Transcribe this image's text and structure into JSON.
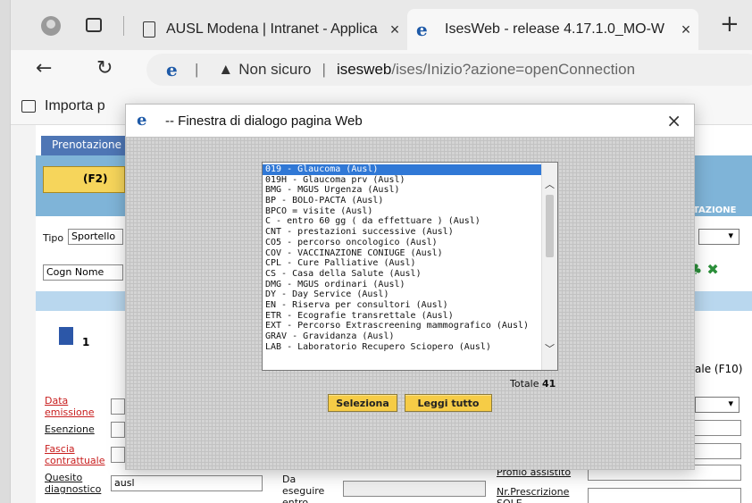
{
  "browser": {
    "tabs": [
      {
        "label": "AUSL Modena | Intranet - Applica",
        "close": "×"
      },
      {
        "label": "IsesWeb - release 4.17.1.0_MO-W",
        "close": "×"
      }
    ],
    "new_tab": "+",
    "address": {
      "security": "Non sicuro",
      "host": "isesweb",
      "path": "/ises/Inizio?azione=openConnection"
    },
    "favorites": [
      {
        "label": "Importa p"
      }
    ]
  },
  "background_page": {
    "top_tab": "Prenotazione",
    "tool_button": "(F2)",
    "header_right": "TAZIONE",
    "fields": {
      "tipo_label": "Tipo",
      "tipo_value": "Sportello",
      "cognome_value": "Cogn Nome",
      "tab_number": "1",
      "f10": "ale (F10)",
      "data_emissione": "Data emissione",
      "esenzione": "Esenzione",
      "fascia": "Fascia contrattuale",
      "quesito": "Quesito diagnostico",
      "quesito_value": "ausl",
      "da_eseguire": "Da eseguire entro",
      "profilo": "Profilo assistito",
      "nr_prescrizione": "Nr.Prescrizione SOLE"
    }
  },
  "dialog": {
    "title": "-- Finestra di dialogo pagina Web",
    "close": "×",
    "items": [
      "019 - Glaucoma (Ausl)",
      "019H - Glaucoma prv (Ausl)",
      "BMG - MGUS Urgenza (Ausl)",
      "BP - BOLO-PACTA (Ausl)",
      "BPCO = visite (Ausl)",
      "C - entro 60 gg ( da effettuare ) (Ausl)",
      "CNT - prestazioni successive (Ausl)",
      "CO5 - percorso oncologico (Ausl)",
      "COV - VACCINAZIONE CONIUGE (Ausl)",
      "CPL - Cure Palliative (Ausl)",
      "CS - Casa della Salute (Ausl)",
      "DMG - MGUS ordinari (Ausl)",
      "DY - Day Service (Ausl)",
      "EN - Riserva per consultori (Ausl)",
      "ETR - Ecografie transrettale (Ausl)",
      "EXT - Percorso Extrascreening mammografico (Ausl)",
      "GRAV - Gravidanza (Ausl)",
      "LAB - Laboratorio Recupero Sciopero (Ausl)"
    ],
    "selected_index": 0,
    "total_label": "Totale",
    "total_value": "41",
    "buttons": {
      "select": "Seleziona",
      "read_all": "Leggi tutto"
    }
  }
}
